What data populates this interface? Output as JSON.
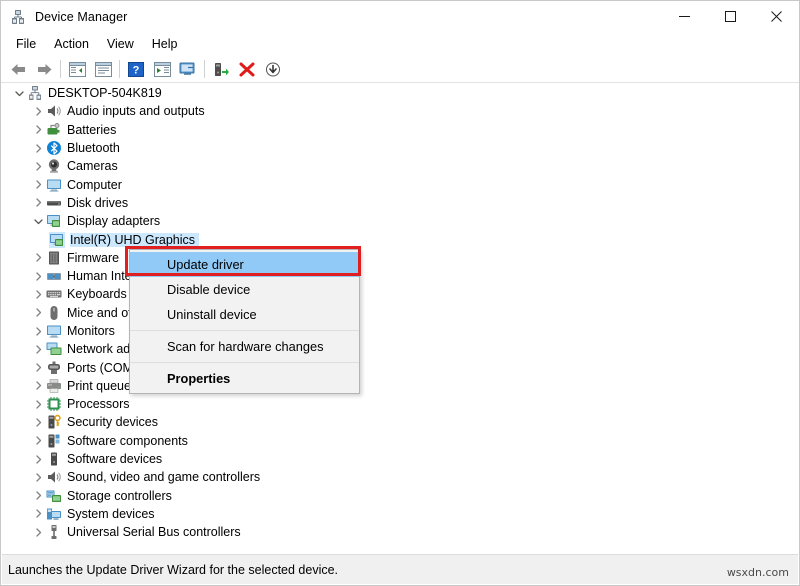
{
  "window": {
    "title": "Device Manager",
    "title_icon": "device-manager-icon",
    "controls": {
      "minimize": "minimize-icon",
      "maximize": "maximize-icon",
      "close": "close-icon"
    }
  },
  "menubar": {
    "items": [
      {
        "label": "File"
      },
      {
        "label": "Action"
      },
      {
        "label": "View"
      },
      {
        "label": "Help"
      }
    ]
  },
  "toolbar": {
    "buttons": [
      {
        "name": "back-arrow-icon"
      },
      {
        "name": "forward-arrow-icon"
      },
      {
        "name": "separator"
      },
      {
        "name": "show-hide-console-tree-icon"
      },
      {
        "name": "properties-icon"
      },
      {
        "name": "separator"
      },
      {
        "name": "help-icon"
      },
      {
        "name": "show-hide-action-pane-icon"
      },
      {
        "name": "scan-for-hardware-changes-icon"
      },
      {
        "name": "separator"
      },
      {
        "name": "update-driver-icon"
      },
      {
        "name": "uninstall-device-icon"
      },
      {
        "name": "disable-device-icon"
      }
    ]
  },
  "tree": {
    "root": {
      "label": "DESKTOP-504K819",
      "icon": "computer-root-icon",
      "expanded": true
    },
    "items": [
      {
        "label": "Audio inputs and outputs",
        "icon": "speaker-icon",
        "expanded": false,
        "level": 1
      },
      {
        "label": "Batteries",
        "icon": "battery-icon",
        "expanded": false,
        "level": 1
      },
      {
        "label": "Bluetooth",
        "icon": "bluetooth-icon",
        "expanded": false,
        "level": 1
      },
      {
        "label": "Cameras",
        "icon": "camera-icon",
        "expanded": false,
        "level": 1
      },
      {
        "label": "Computer",
        "icon": "monitor-icon",
        "expanded": false,
        "level": 1
      },
      {
        "label": "Disk drives",
        "icon": "disk-drive-icon",
        "expanded": false,
        "level": 1
      },
      {
        "label": "Display adapters",
        "icon": "display-adapter-icon",
        "expanded": true,
        "level": 1
      },
      {
        "label": "Intel(R) UHD Graphics",
        "icon": "display-adapter-icon",
        "selected": true,
        "level": 2
      },
      {
        "label": "Firmware",
        "icon": "firmware-icon",
        "expanded": false,
        "level": 1
      },
      {
        "label": "Human Interface Devices",
        "icon": "hid-icon",
        "expanded": false,
        "level": 1
      },
      {
        "label": "Keyboards",
        "icon": "keyboard-icon",
        "expanded": false,
        "level": 1
      },
      {
        "label": "Mice and other pointing devices",
        "icon": "mouse-icon",
        "expanded": false,
        "level": 1
      },
      {
        "label": "Monitors",
        "icon": "monitor-icon",
        "expanded": false,
        "level": 1
      },
      {
        "label": "Network adapters",
        "icon": "network-adapter-icon",
        "expanded": false,
        "level": 1
      },
      {
        "label": "Ports (COM & LPT)",
        "icon": "port-icon",
        "expanded": false,
        "level": 1
      },
      {
        "label": "Print queues",
        "icon": "printer-icon",
        "expanded": false,
        "level": 1
      },
      {
        "label": "Processors",
        "icon": "processor-icon",
        "expanded": false,
        "level": 1
      },
      {
        "label": "Security devices",
        "icon": "security-device-icon",
        "expanded": false,
        "level": 1
      },
      {
        "label": "Software components",
        "icon": "software-component-icon",
        "expanded": false,
        "level": 1
      },
      {
        "label": "Software devices",
        "icon": "software-device-icon",
        "expanded": false,
        "level": 1
      },
      {
        "label": "Sound, video and game controllers",
        "icon": "speaker-icon",
        "expanded": false,
        "level": 1
      },
      {
        "label": "Storage controllers",
        "icon": "storage-controller-icon",
        "expanded": false,
        "level": 1
      },
      {
        "label": "System devices",
        "icon": "system-device-icon",
        "expanded": false,
        "level": 1
      },
      {
        "label": "Universal Serial Bus controllers",
        "icon": "usb-icon",
        "expanded": false,
        "level": 1
      }
    ]
  },
  "context_menu": {
    "items": [
      {
        "label": "Update driver",
        "highlighted": true,
        "bold": false
      },
      {
        "label": "Disable device",
        "highlighted": false,
        "bold": false
      },
      {
        "label": "Uninstall device",
        "highlighted": false,
        "bold": false
      },
      {
        "separator": true
      },
      {
        "label": "Scan for hardware changes",
        "highlighted": false,
        "bold": false
      },
      {
        "separator": true
      },
      {
        "label": "Properties",
        "highlighted": false,
        "bold": true
      }
    ]
  },
  "statusbar": {
    "text": "Launches the Update Driver Wizard for the selected device."
  },
  "watermark": {
    "text": "wsxdn.com"
  },
  "colors": {
    "selection_blue": "#cce8ff",
    "menu_highlight": "#91c9f7",
    "annotation_red": "#e02020",
    "menu_bg": "#f2f2f2",
    "statusbar_bg": "#f0f0f0"
  }
}
